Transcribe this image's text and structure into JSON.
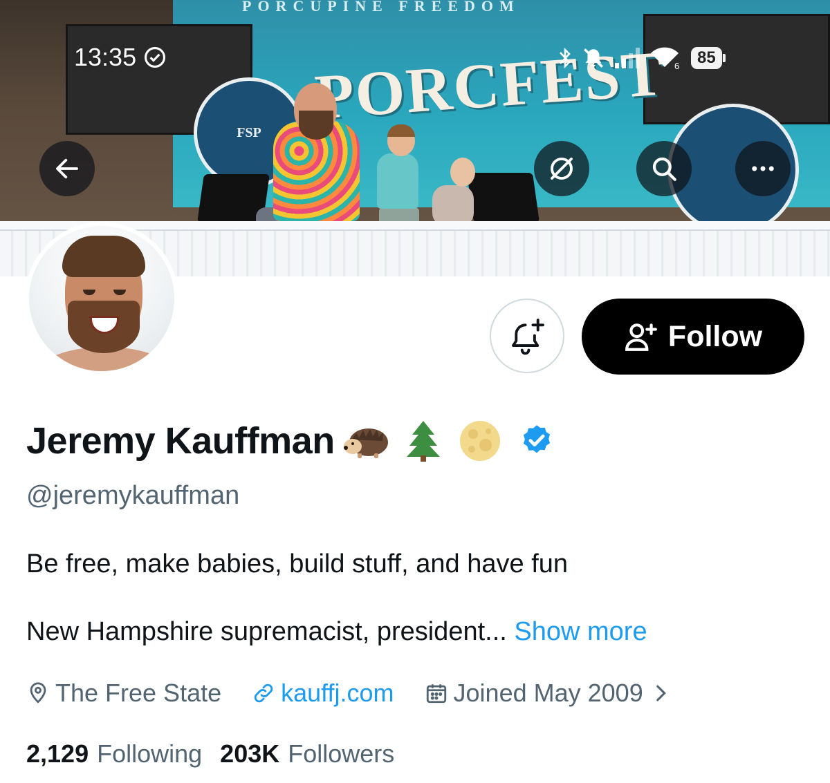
{
  "status_bar": {
    "time": "13:35",
    "battery": "85"
  },
  "banner": {
    "top_text": "PORCUPINE FREEDOM",
    "sign_text": "PORCFEST",
    "seal_text": "FSP"
  },
  "header_actions": {
    "back_icon": "arrow-left-icon",
    "grok_icon": "grok-icon",
    "search_icon": "search-icon",
    "more_icon": "more-horizontal-icon"
  },
  "actions": {
    "notify_icon": "bell-plus-icon",
    "follow_label": "Follow"
  },
  "profile": {
    "name": "Jeremy Kauffman",
    "emojis": [
      "hedgehog",
      "evergreen-tree",
      "full-moon"
    ],
    "verified": true,
    "handle": "@jeremykauffman",
    "bio_line1": "Be free, make babies, build stuff, and have fun",
    "bio_line2": "New Hampshire supremacist, president...",
    "show_more": "Show more",
    "location": "The Free State",
    "website": "kauffj.com",
    "joined": "Joined May 2009"
  },
  "stats": {
    "following_count": "2,129",
    "following_label": "Following",
    "followers_count": "203K",
    "followers_label": "Followers"
  },
  "colors": {
    "accent": "#1d9bf0",
    "secondary_text": "#536471",
    "primary_text": "#0f1419",
    "follow_bg": "#000000"
  }
}
